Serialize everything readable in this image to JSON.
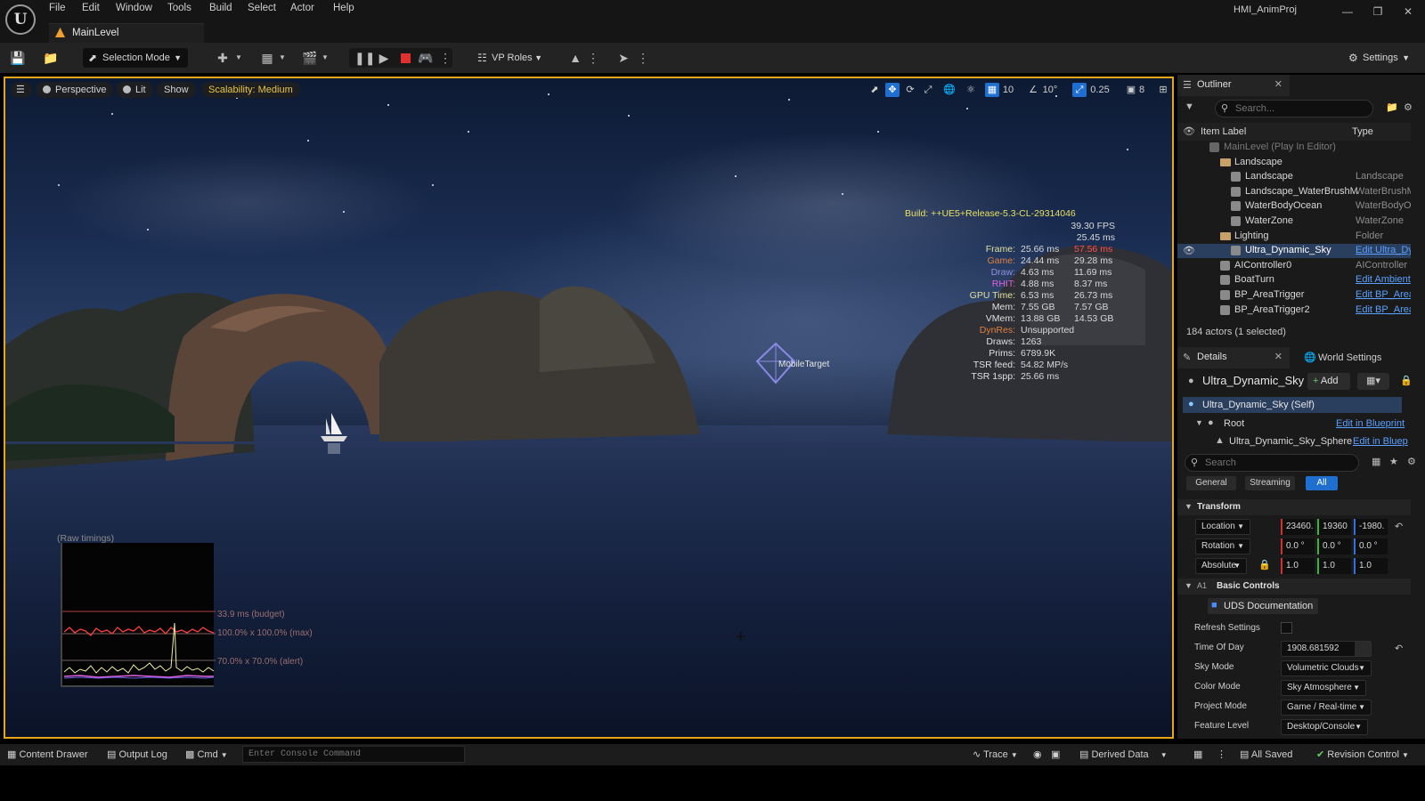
{
  "app": {
    "logo_text": "U",
    "project_name": "HMI_AnimProj",
    "level_tab": "MainLevel"
  },
  "menu": [
    "File",
    "Edit",
    "Window",
    "Tools",
    "Build",
    "Select",
    "Actor",
    "Help"
  ],
  "toolbar": {
    "selection_mode": "Selection Mode",
    "vp_roles": "VP Roles",
    "settings": "Settings"
  },
  "viewport": {
    "perspective": "Perspective",
    "lit": "Lit",
    "show": "Show",
    "scalability": "Scalability: Medium",
    "grid_size": "10",
    "rot_snap": "10°",
    "scale_snap": "0.25",
    "cam_speed": "8",
    "target_label": "MobileTarget",
    "graph_title": "(Raw timings)",
    "graph_budget": "33.9 ms (budget)",
    "graph_max": "100.0% x 100.0% (max)",
    "graph_alert": "70.0% x 70.0% (alert)"
  },
  "stats": {
    "build": "Build: ++UE5+Release-5.3-CL-29314046",
    "fps": "39.30 FPS",
    "ms": "25.45 ms",
    "rows": [
      {
        "label": "Frame:",
        "v1": "25.66 ms",
        "v2": "57.56 ms",
        "lc": "#e0e0a0",
        "v2red": true
      },
      {
        "label": "Game:",
        "v1": "24.44 ms",
        "v2": "29.28 ms",
        "lc": "#e08040",
        "v2red": false
      },
      {
        "label": "Draw:",
        "v1": "4.63 ms",
        "v2": "11.69 ms",
        "lc": "#9090e0",
        "v2red": false
      },
      {
        "label": "RHIT:",
        "v1": "4.88 ms",
        "v2": "8.37 ms",
        "lc": "#e060e0",
        "v2red": false
      },
      {
        "label": "GPU Time:",
        "v1": "6.53 ms",
        "v2": "26.73 ms",
        "lc": "#e0e0a0",
        "v2red": false
      },
      {
        "label": "Mem:",
        "v1": "7.55 GB",
        "v2": "7.57 GB",
        "lc": "#e0e0e0",
        "v2red": false
      },
      {
        "label": "VMem:",
        "v1": "13.88 GB",
        "v2": "14.53 GB",
        "lc": "#e0e0e0",
        "v2red": false
      },
      {
        "label": "DynRes:",
        "v1": "Unsupported",
        "v2": "",
        "lc": "#e08040",
        "v2red": false
      },
      {
        "label": "Draws:",
        "v1": "1263",
        "v2": "",
        "lc": "#e0e0e0",
        "v2red": false
      },
      {
        "label": "Prims:",
        "v1": "6789.9K",
        "v2": "",
        "lc": "#e0e0e0",
        "v2red": false
      },
      {
        "label": "TSR feed:",
        "v1": "54.82 MP/s",
        "v2": "",
        "lc": "#e0e0e0",
        "v2red": false
      },
      {
        "label": "TSR 1spp:",
        "v1": "25.66 ms",
        "v2": "",
        "lc": "#e0e0e0",
        "v2red": false
      }
    ]
  },
  "outliner": {
    "tab": "Outliner",
    "search_placeholder": "Search...",
    "col_label": "Item Label",
    "col_type": "Type",
    "rows": [
      {
        "name": "MainLevel (Play In Editor)",
        "type": "",
        "indent": 0,
        "kind": "level",
        "dim": true
      },
      {
        "name": "Landscape",
        "type": "",
        "indent": 1,
        "kind": "folder"
      },
      {
        "name": "Landscape",
        "type": "Landscape",
        "indent": 2,
        "kind": "actor"
      },
      {
        "name": "Landscape_WaterBrushM",
        "type": "WaterBrushM",
        "indent": 2,
        "kind": "actor"
      },
      {
        "name": "WaterBodyOcean",
        "type": "WaterBodyOc",
        "indent": 2,
        "kind": "actor"
      },
      {
        "name": "WaterZone",
        "type": "WaterZone",
        "indent": 2,
        "kind": "actor"
      },
      {
        "name": "Lighting",
        "type": "Folder",
        "indent": 1,
        "kind": "folder"
      },
      {
        "name": "Ultra_Dynamic_Sky",
        "type": "Edit Ultra_Dy",
        "indent": 2,
        "kind": "actor",
        "selected": true,
        "link": true
      },
      {
        "name": "AIController0",
        "type": "AIController",
        "indent": 1,
        "kind": "actor"
      },
      {
        "name": "BoatTurn",
        "type": "Edit Ambient",
        "indent": 1,
        "kind": "actor",
        "link": true
      },
      {
        "name": "BP_AreaTrigger",
        "type": "Edit BP_Area",
        "indent": 1,
        "kind": "actor",
        "link": true
      },
      {
        "name": "BP_AreaTrigger2",
        "type": "Edit BP_Area",
        "indent": 1,
        "kind": "actor",
        "link": true
      }
    ],
    "count": "184 actors (1 selected)"
  },
  "details": {
    "tab": "Details",
    "world_tab": "World Settings",
    "actor_name": "Ultra_Dynamic_Sky",
    "add": "Add",
    "self": "Ultra_Dynamic_Sky (Self)",
    "root": "Root",
    "edit_bp": "Edit in Blueprint",
    "sphere": "Ultra_Dynamic_Sky_Sphere",
    "edit_bp2": "Edit in Bluep",
    "search_placeholder": "Search",
    "filters": [
      "General",
      "Streaming",
      "All"
    ],
    "transform": "Transform",
    "location": "Location",
    "rotation": "Rotation",
    "scale": "Absolute",
    "loc": [
      "23460.",
      "19360",
      "-1980."
    ],
    "rot": [
      "0.0 °",
      "0.0 °",
      "0.0 °"
    ],
    "scl": [
      "1.0",
      "1.0",
      "1.0"
    ],
    "section_prefix": "A1",
    "section": "Basic Controls",
    "uds_doc": "UDS Documentation",
    "refresh": "Refresh Settings",
    "time_of_day": "Time Of Day",
    "time_value": "1908.681592",
    "sky_mode": "Sky Mode",
    "sky_mode_v": "Volumetric Clouds",
    "color_mode": "Color Mode",
    "color_mode_v": "Sky Atmosphere",
    "project_mode": "Project Mode",
    "project_mode_v": "Game / Real-time",
    "feature_level": "Feature Level",
    "feature_level_v": "Desktop/Console"
  },
  "statusbar": {
    "content_drawer": "Content Drawer",
    "output_log": "Output Log",
    "cmd": "Cmd",
    "console_placeholder": "Enter Console Command",
    "trace": "Trace",
    "derived": "Derived Data",
    "saved": "All Saved",
    "revision": "Revision Control"
  }
}
